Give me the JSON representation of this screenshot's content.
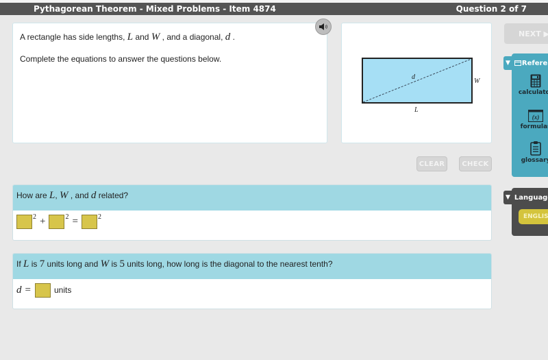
{
  "header": {
    "title": "Pythagorean Theorem - Mixed Problems - Item 4874",
    "question_counter": "Question 2 of 7"
  },
  "intro": {
    "line1_prefix": "A rectangle has side lengths, ",
    "var_L": "L",
    "and": " and ",
    "var_W": "W",
    "line1_mid": " , and a diagonal, ",
    "var_d": "d",
    "line1_suffix": " .",
    "line2": "Complete the equations to answer the questions below."
  },
  "audio": {
    "icon": "speaker-icon"
  },
  "figure": {
    "label_d": "d",
    "label_W": "W",
    "label_L": "L",
    "fill_color": "#a6dff5",
    "stroke_color": "#222222"
  },
  "buttons": {
    "clear": "CLEAR",
    "check": "CHECK",
    "next": "NEXT ▶"
  },
  "reference_panel": {
    "header": "Reference",
    "items": [
      {
        "label": "calculator",
        "icon": "calculator-icon"
      },
      {
        "label": "formulas",
        "icon": "formulas-icon",
        "glyph": "(x)"
      },
      {
        "label": "glossary",
        "icon": "clipboard-icon"
      }
    ]
  },
  "language_panel": {
    "header": "Language",
    "selected": "ENGLISH"
  },
  "question1": {
    "prompt_prefix": "How are ",
    "var_L": "L",
    "comma1": ", ",
    "var_W": "W",
    "mid": " , and ",
    "var_d": "d",
    "suffix": " related?",
    "exponent": "2",
    "plus": "+",
    "equals": "="
  },
  "question2": {
    "prefix": "If ",
    "var_L": "L",
    "is": " is ",
    "L_value": "7",
    "mid1": " units long and ",
    "var_W": "W",
    "is2": "  is ",
    "W_value": "5",
    "suffix": " units long, how long is the diagonal to the nearest tenth?",
    "answer_var": "d",
    "equals": "=",
    "units": "units"
  },
  "colors": {
    "topbar": "#545454",
    "question_header": "#9fd8e3",
    "answer_box": "#d7c54b",
    "reference_panel": "#4ba9bf",
    "language_panel": "#4c4c4c",
    "english_button": "#d4c43c"
  }
}
